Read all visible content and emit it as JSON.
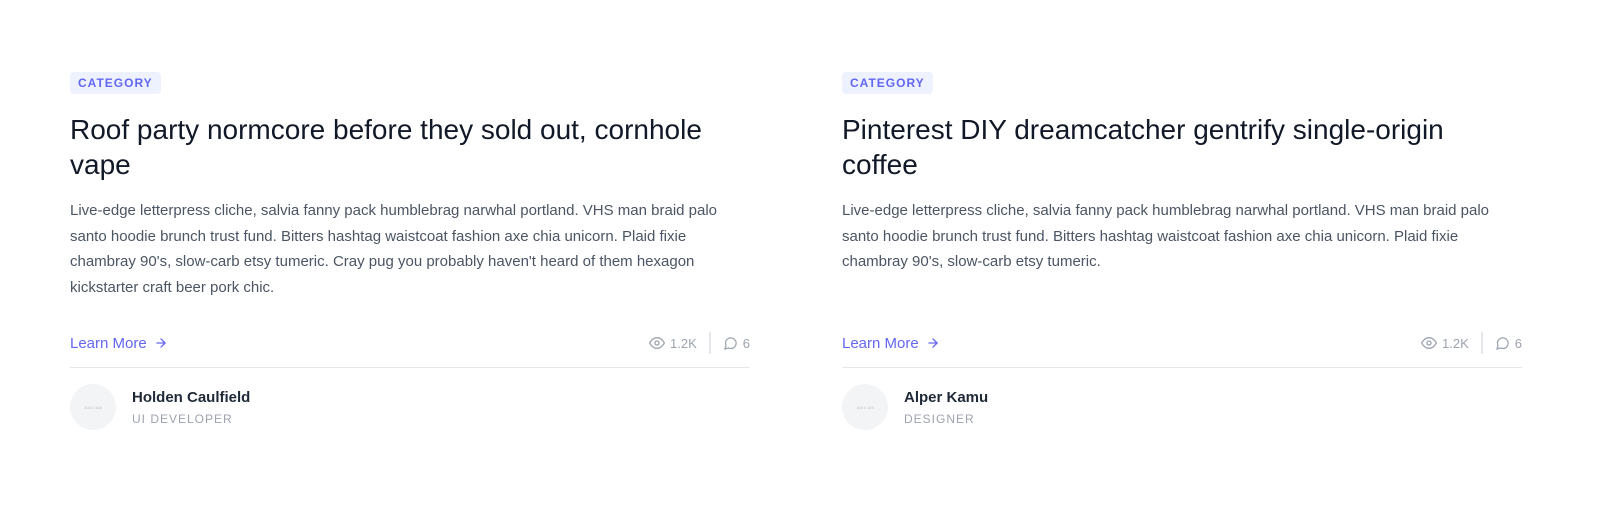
{
  "cards": [
    {
      "category": "CATEGORY",
      "title": "Roof party normcore before they sold out, cornhole vape",
      "description": "Live-edge letterpress cliche, salvia fanny pack humblebrag narwhal portland. VHS man braid palo santo hoodie brunch trust fund. Bitters hashtag waistcoat fashion axe chia unicorn. Plaid fixie chambray 90's, slow-carb etsy tumeric. Cray pug you probably haven't heard of them hexagon kickstarter craft beer pork chic.",
      "learn_more": "Learn More",
      "views": "1.2K",
      "comments": "6",
      "author_name": "Holden Caulfield",
      "author_role": "UI DEVELOPER",
      "avatar_text": "104 x 104"
    },
    {
      "category": "CATEGORY",
      "title": "Pinterest DIY dreamcatcher gentrify single-origin coffee",
      "description": "Live-edge letterpress cliche, salvia fanny pack humblebrag narwhal portland. VHS man braid palo santo hoodie brunch trust fund. Bitters hashtag waistcoat fashion axe chia unicorn. Plaid fixie chambray 90's, slow-carb etsy tumeric.",
      "learn_more": "Learn More",
      "views": "1.2K",
      "comments": "6",
      "author_name": "Alper Kamu",
      "author_role": "DESIGNER",
      "avatar_text": "104 x 104"
    }
  ],
  "icons": {
    "learn_more": "arrow-right-icon",
    "views": "eye-icon",
    "comments": "chat-bubble-icon"
  },
  "colors": {
    "accent": "#6366f1",
    "badge_bg": "#eef2ff",
    "muted": "#9ca3af",
    "text": "#4b5563"
  }
}
